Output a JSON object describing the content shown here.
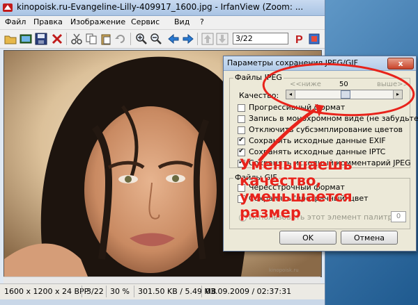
{
  "window": {
    "title": "kinopoisk.ru-Evangeline-Lilly-409917_1600.jpg - IrfanView (Zoom: ..."
  },
  "menu": {
    "items": [
      "Файл",
      "Правка",
      "Изображение",
      "Сервис",
      "Вид",
      "?"
    ]
  },
  "toolbar": {
    "page_field": "3/22",
    "icons": [
      "open-icon",
      "slideshow-icon",
      "save-icon",
      "delete-icon",
      "cut-icon",
      "copy-icon",
      "paste-icon",
      "undo-icon",
      "zoom-in-icon",
      "zoom-out-icon",
      "prev-icon",
      "next-icon",
      "first-icon",
      "last-icon",
      "paint-icon",
      "about-icon"
    ]
  },
  "image": {
    "watermark": "kinopoisk.ru"
  },
  "status": {
    "resolution": "1600 x 1200 x 24 BPP",
    "index": "3/22",
    "zoom": "30 %",
    "size": "301.50 KB / 5.49 MB",
    "datetime": "03.09.2009 / 02:37:31"
  },
  "dialog": {
    "title": "Параметры сохранения JPEG/GIF",
    "close_label": "x",
    "jpeg_group_label": "Файлы JPEG",
    "slider_low": "<<ниже",
    "slider_value": "50",
    "slider_high": "выше>>",
    "quality_label": "Качество:",
    "quality_value": 50,
    "options": [
      {
        "label": "Прогрессивный формат",
        "checked": false
      },
      {
        "label": "Запись в монохромном виде (не забудьте!)",
        "checked": false
      },
      {
        "label": "Отключить субсэмплирование цветов",
        "checked": false
      },
      {
        "label": "Сохранять исходные данные EXIF",
        "checked": true
      },
      {
        "label": "Сохранять исходные данные IPTC",
        "checked": true
      },
      {
        "label": "Сохранять исходный комментарий JPEG",
        "checked": true
      }
    ],
    "gif_group_label": "Файлы GIF",
    "gif_options": [
      {
        "label": "Чересстрочный формат",
        "checked": false
      },
      {
        "label": "Сохранять 'прозрачный' цвет",
        "checked": false
      }
    ],
    "palette_label": "Использовать этот элемент палитры:",
    "palette_value": "0",
    "ok_label": "OK",
    "cancel_label": "Отмена"
  },
  "annotation": {
    "lines": [
      "Уменьшаешь",
      "качество,",
      "уменьшается",
      "размер"
    ],
    "color": "#e8231b"
  }
}
